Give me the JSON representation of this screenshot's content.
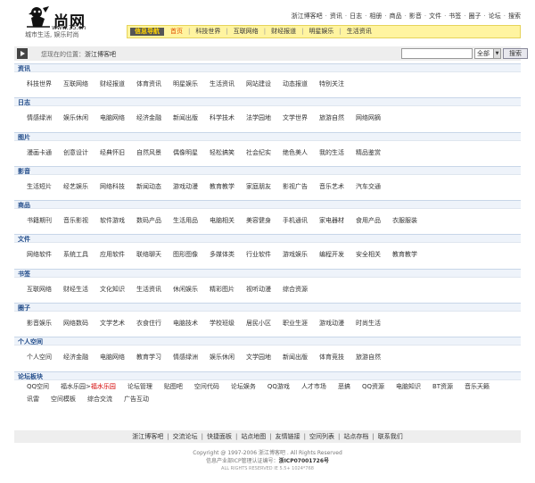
{
  "header": {
    "logo_title": "尚网",
    "logo_url": "www.35.cn",
    "logo_slogan": "城市生活, 娱乐时尚",
    "top_links": [
      "浙江博客吧",
      "资讯",
      "日志",
      "相册",
      "商品",
      "影音",
      "文件",
      "书签",
      "圈子",
      "论坛",
      "搜索"
    ]
  },
  "nav": {
    "label": "信息导航",
    "items": [
      "首页",
      "科技世界",
      "互联网络",
      "财经报道",
      "明星娱乐",
      "生活资讯"
    ],
    "active_index": 0
  },
  "search": {
    "location_prefix": "您现在的位置：",
    "location_site": "浙江博客吧",
    "input_value": "",
    "select_value": "全部",
    "button_label": "搜索"
  },
  "sections": [
    {
      "title": "资讯",
      "items": [
        "科技世界",
        "互联网络",
        "财经报道",
        "体育资讯",
        "明星娱乐",
        "生活资讯",
        "网站建设",
        "动态报道",
        "特别关注"
      ]
    },
    {
      "title": "日志",
      "items": [
        "情感绿洲",
        "娱乐休闲",
        "电脑网络",
        "经济金融",
        "新闻出版",
        "科学技术",
        "法学园地",
        "文学世界",
        "旅游自然",
        "网络网摘"
      ]
    },
    {
      "title": "图片",
      "items": [
        "漫画卡通",
        "创意设计",
        "经典怀旧",
        "自然风景",
        "偶像明星",
        "轻松搞笑",
        "社会纪实",
        "绝色美人",
        "我的生活",
        "精品鉴赏"
      ]
    },
    {
      "title": "影音",
      "items": [
        "生活短片",
        "经艺娱乐",
        "网络科技",
        "新闻动态",
        "游戏动漫",
        "教育教学",
        "家庭朋友",
        "影视广告",
        "音乐艺术",
        "汽车交通"
      ]
    },
    {
      "title": "商品",
      "items": [
        "书籍期刊",
        "音乐影视",
        "软件游戏",
        "数码产品",
        "生活用品",
        "电脑相关",
        "美容健身",
        "手机通讯",
        "家电器材",
        "食用产品",
        "衣服服装"
      ]
    },
    {
      "title": "文件",
      "items": [
        "网络软件",
        "系统工具",
        "应用软件",
        "联络聊天",
        "图形图像",
        "多媒体类",
        "行业软件",
        "游戏娱乐",
        "编程开发",
        "安全相关",
        "教育教学"
      ]
    },
    {
      "title": "书签",
      "items": [
        "互联网络",
        "财经生活",
        "文化知识",
        "生活资讯",
        "休闲娱乐",
        "精彩图片",
        "视听动漫",
        "综合资源"
      ]
    },
    {
      "title": "圈子",
      "items": [
        "影音娱乐",
        "网络数码",
        "文学艺术",
        "衣食住行",
        "电脑技术",
        "学校班级",
        "居民小区",
        "职业生涯",
        "游戏动漫",
        "时尚生活"
      ]
    },
    {
      "title": "个人空间",
      "items": [
        "个人空间",
        "经济金融",
        "电脑网络",
        "教育学习",
        "情感绿洲",
        "娱乐休闲",
        "文学园地",
        "新闻出版",
        "体育竞技",
        "旅游自然"
      ]
    }
  ],
  "forum": {
    "title": "论坛板块",
    "row1": [
      "QQ空间",
      "福水乐园",
      "福水乐园",
      "论坛管理",
      "贴图吧",
      "空间代码",
      "论坛娱务",
      "QQ游戏",
      "人才市场",
      "恶搞",
      "QQ资源",
      "电脑知识",
      "BT资源",
      "音乐天籁"
    ],
    "row1_first_prefix": "",
    "row2": [
      "讯雷",
      "空间模板",
      "综合交流",
      "广告互动"
    ]
  },
  "footer": {
    "links": [
      "浙江博客吧",
      "交流论坛",
      "快捷面板",
      "站点地图",
      "友情链接",
      "空间列表",
      "站点存档",
      "联系我们"
    ],
    "copyright": "Copyright @ 1997-2006 浙江博客吧 . All Rights Reserved",
    "icp_prefix": "信息产业部ICP管理认证编号：",
    "icp_number": "浙ICP07001726号",
    "rights": "ALL RIGHTS RESERVED IE 5.5+ 1024*768"
  }
}
